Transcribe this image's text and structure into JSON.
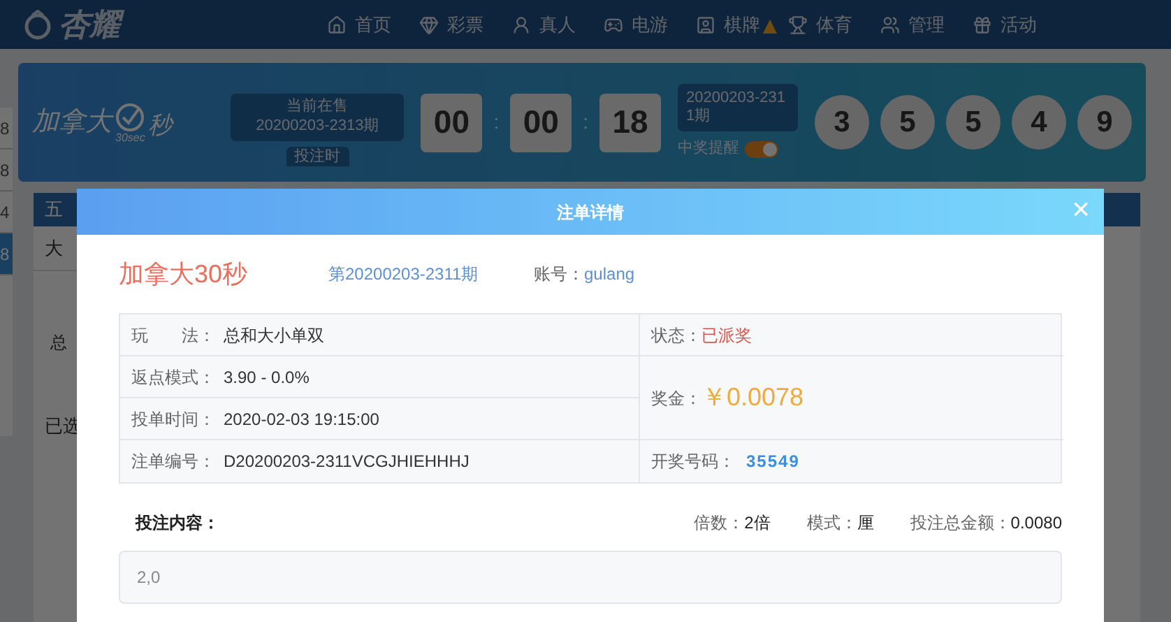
{
  "nav": {
    "logo": "杏耀",
    "items": [
      {
        "label": "首页",
        "badge": false
      },
      {
        "label": "彩票",
        "badge": false
      },
      {
        "label": "真人",
        "badge": false
      },
      {
        "label": "电游",
        "badge": false
      },
      {
        "label": "棋牌",
        "badge": true
      },
      {
        "label": "体育",
        "badge": false
      },
      {
        "label": "管理",
        "badge": false
      },
      {
        "label": "活动",
        "badge": false
      }
    ]
  },
  "side_strip": [
    "8",
    "8",
    "4",
    "8"
  ],
  "lottery_bar": {
    "logo": {
      "name": "加拿大",
      "unit": "秒",
      "sub": "30sec"
    },
    "current": {
      "label": "当前在售",
      "issue": "20200203-2313期"
    },
    "tab": "投注时",
    "countdown": [
      "00",
      "00",
      "18"
    ],
    "separator": ":",
    "last_issue": "20200203-2311期",
    "reminder": {
      "label": "中奖提醒",
      "on": true
    },
    "balls": [
      "3",
      "5",
      "5",
      "4",
      "9"
    ]
  },
  "background": {
    "panel_title": "五",
    "row_text": "大",
    "note": "总",
    "selected": "已选"
  },
  "modal": {
    "title": "注单详情",
    "close": "×",
    "game": "加拿大30秒",
    "issue": "第20200203-2311期",
    "account_label": "账号：",
    "account": "gulang",
    "rows": [
      {
        "label": "玩　　法：",
        "value": "总和大小单双"
      },
      {
        "label": "返点模式：",
        "value": "3.90 - 0.0%"
      },
      {
        "label": "投单时间：",
        "value": "2020-02-03 19:15:00"
      },
      {
        "label": "注单编号：",
        "value": "D20200203-2311VCGJHIEHHHJ"
      }
    ],
    "status_label": "状态：",
    "status": "已派奖",
    "prize_label": "奖金：",
    "prize": "￥0.0078",
    "draw_label": "开奖号码：",
    "draw": "35549",
    "content_label": "投注内容：",
    "stats": [
      {
        "label": "倍数：",
        "value": "2倍"
      },
      {
        "label": "模式：",
        "value": "厘"
      },
      {
        "label": "投注总金额：",
        "value": "0.0080"
      }
    ],
    "content": "2,0"
  }
}
